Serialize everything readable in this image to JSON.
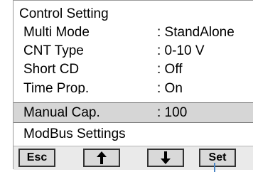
{
  "title": "Control Setting",
  "menu": [
    {
      "label": "Multi Mode",
      "value": ": StandAlone"
    },
    {
      "label": "CNT Type",
      "value": ": 0-10 V"
    },
    {
      "label": "Short CD",
      "value": ": Off"
    },
    {
      "label": "Time Prop.",
      "value": ": On"
    },
    {
      "label": "Manual Cap.",
      "value": ": 100"
    }
  ],
  "selected_index": 4,
  "modbus_label": "ModBus Settings",
  "buttons": {
    "esc": "Esc",
    "up_icon": "arrow-up-icon",
    "down_icon": "arrow-down-icon",
    "set": "Set"
  },
  "colors": {
    "selection": "#d6d6d6",
    "pointer": "#4a86c5"
  }
}
